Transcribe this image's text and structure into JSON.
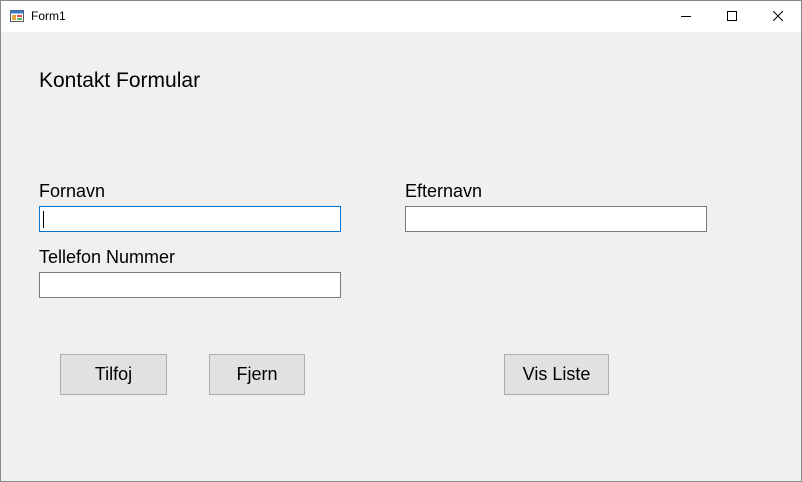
{
  "window": {
    "title": "Form1",
    "app_icon": "winforms-app-icon",
    "controls": {
      "minimize_icon": "minimize-icon",
      "maximize_icon": "maximize-icon",
      "close_icon": "close-icon"
    }
  },
  "form": {
    "heading": "Kontakt Formular",
    "fields": {
      "first_name": {
        "label": "Fornavn",
        "value": ""
      },
      "last_name": {
        "label": "Efternavn",
        "value": ""
      },
      "phone": {
        "label": "Tellefon Nummer",
        "value": ""
      }
    },
    "buttons": {
      "add": "Tilfoj",
      "remove": "Fjern",
      "show_list": "Vis Liste"
    }
  },
  "colors": {
    "client_background": "#f0f0f0",
    "focus_border": "#0078d7",
    "button_face": "#e1e1e1"
  }
}
